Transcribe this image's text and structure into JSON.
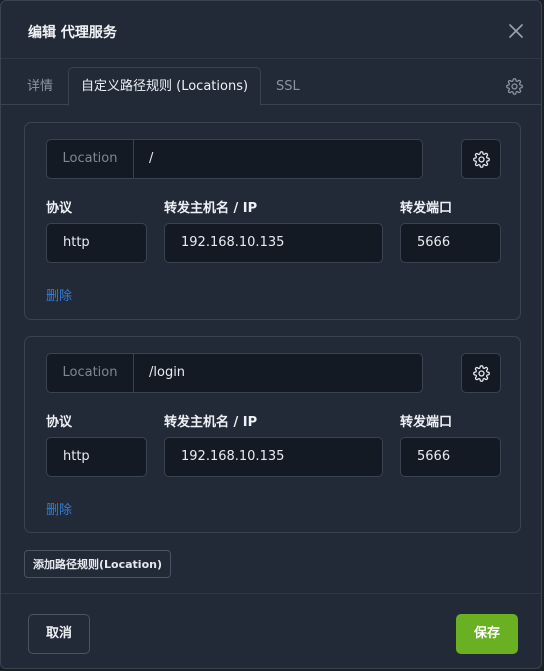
{
  "dialog": {
    "title": "编辑 代理服务"
  },
  "tabs": [
    {
      "label": "详情",
      "active": false
    },
    {
      "label": "自定义路径规则 (Locations)",
      "active": true
    },
    {
      "label": "SSL",
      "active": false
    }
  ],
  "labels": {
    "protocol": "协议",
    "host": "转发主机名 / IP",
    "port": "转发端口",
    "delete": "删除",
    "location_addon": "Location"
  },
  "locations": [
    {
      "path": "/",
      "protocol": "http",
      "host": "192.168.10.135",
      "port": "5666"
    },
    {
      "path": "/login",
      "protocol": "http",
      "host": "192.168.10.135",
      "port": "5666"
    }
  ],
  "actions": {
    "add_location": "添加路径规则(Location)",
    "cancel": "取消",
    "save": "保存"
  },
  "colors": {
    "accent_save": "#6ab023",
    "link": "#2f7fd6",
    "background": "#232a37"
  },
  "icons": [
    "close-icon",
    "gear-icon"
  ]
}
